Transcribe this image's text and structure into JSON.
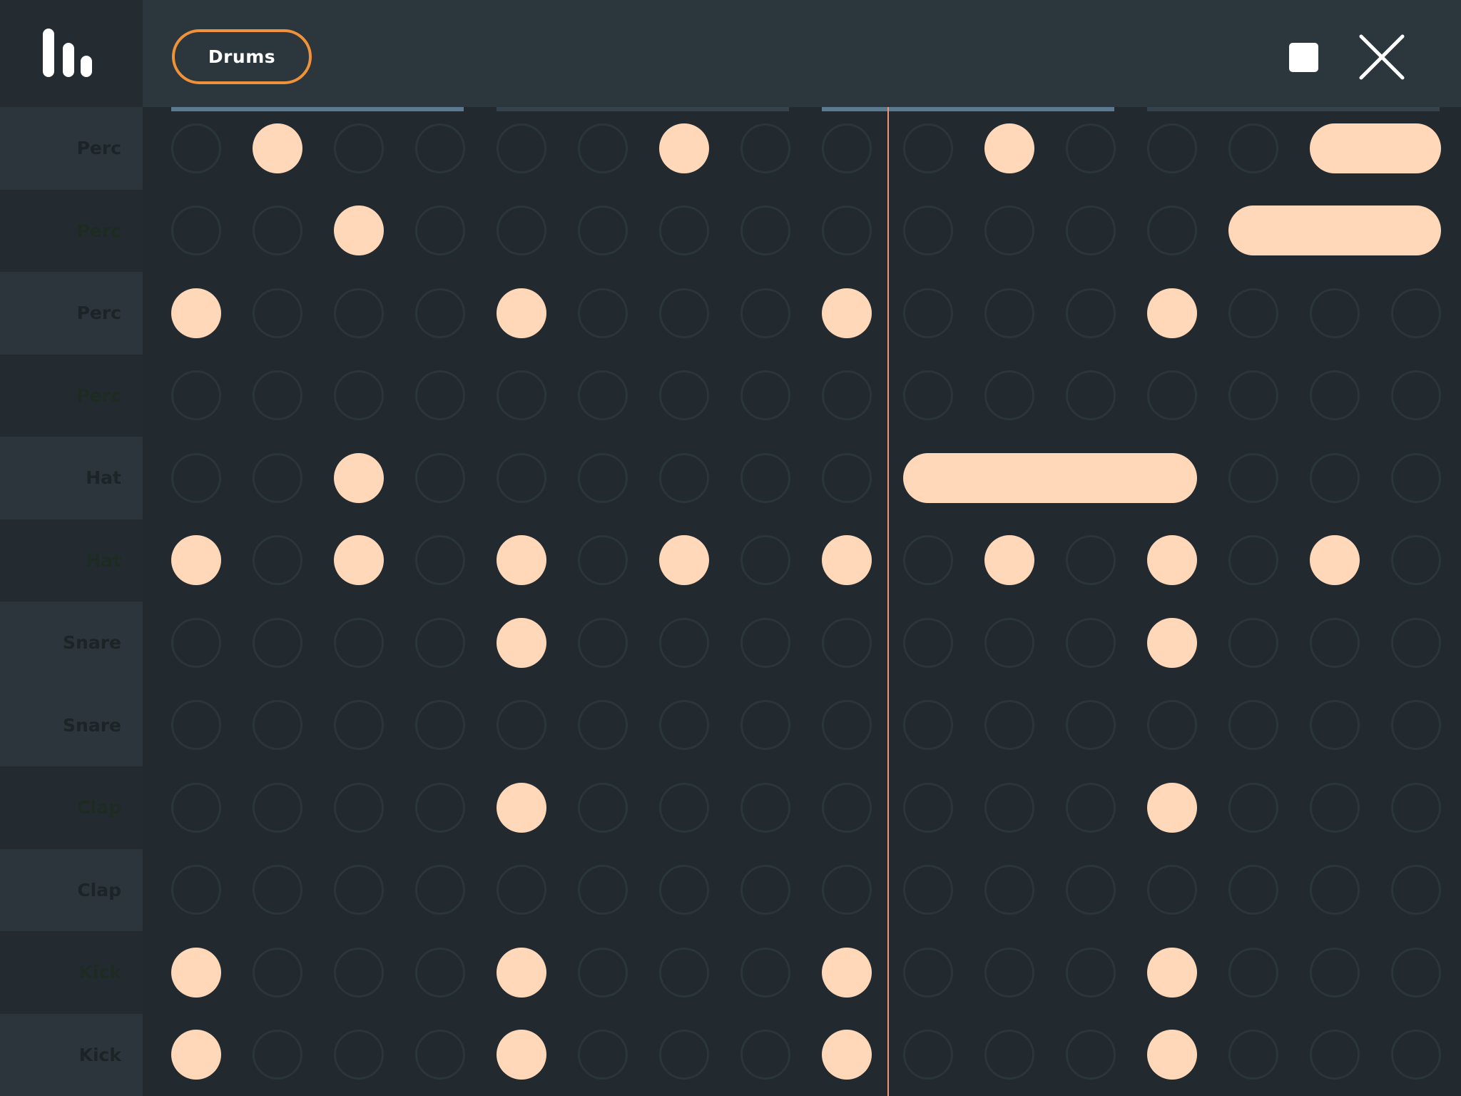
{
  "header": {
    "kit_label": "Drums",
    "logo_icon": "equalizer-bars-icon",
    "stop_icon": "stop-square-icon",
    "close_icon": "close-x-icon"
  },
  "colors": {
    "background": "#222a30",
    "topbar": "#2c363d",
    "accent_orange": "#f0923a",
    "note_fill": "#fed8b8",
    "empty_cell_ring": "#2b353c",
    "playhead": "#f39478",
    "bar_active": "#5b7a8f",
    "bar_inactive": "#34434d"
  },
  "sequencer": {
    "steps": 16,
    "playhead_step": 9,
    "bars": [
      {
        "active": true
      },
      {
        "active": false
      },
      {
        "active": true
      },
      {
        "active": false
      }
    ],
    "tracks": [
      {
        "label": "Perc",
        "shade": "light",
        "label_color": "dark",
        "notes": [
          [
            1,
            1
          ],
          [
            6,
            1
          ],
          [
            10,
            1
          ],
          [
            14,
            2
          ]
        ]
      },
      {
        "label": "Perc",
        "shade": "dark",
        "label_color": "green",
        "notes": [
          [
            2,
            1
          ],
          [
            13,
            3
          ]
        ]
      },
      {
        "label": "Perc",
        "shade": "light",
        "label_color": "dark",
        "notes": [
          [
            0,
            1
          ],
          [
            4,
            1
          ],
          [
            8,
            1
          ],
          [
            12,
            1
          ]
        ]
      },
      {
        "label": "Perc",
        "shade": "dark",
        "label_color": "green",
        "notes": []
      },
      {
        "label": "Hat",
        "shade": "light",
        "label_color": "dark",
        "notes": [
          [
            2,
            1
          ],
          [
            9,
            4
          ]
        ]
      },
      {
        "label": "Hat",
        "shade": "dark",
        "label_color": "green",
        "notes": [
          [
            0,
            1
          ],
          [
            2,
            1
          ],
          [
            4,
            1
          ],
          [
            6,
            1
          ],
          [
            8,
            1
          ],
          [
            10,
            1
          ],
          [
            12,
            1
          ],
          [
            14,
            1
          ]
        ]
      },
      {
        "label": "Snare",
        "shade": "light",
        "label_color": "dark",
        "notes": [
          [
            4,
            1
          ],
          [
            12,
            1
          ]
        ]
      },
      {
        "label": "Snare",
        "shade": "light",
        "label_color": "dark",
        "notes": []
      },
      {
        "label": "Clap",
        "shade": "dark",
        "label_color": "green",
        "notes": [
          [
            4,
            1
          ],
          [
            12,
            1
          ]
        ]
      },
      {
        "label": "Clap",
        "shade": "light",
        "label_color": "dark",
        "notes": []
      },
      {
        "label": "Kick",
        "shade": "dark",
        "label_color": "green",
        "notes": [
          [
            0,
            1
          ],
          [
            4,
            1
          ],
          [
            8,
            1
          ],
          [
            12,
            1
          ]
        ]
      },
      {
        "label": "Kick",
        "shade": "light",
        "label_color": "dark",
        "notes": [
          [
            0,
            1
          ],
          [
            4,
            1
          ],
          [
            8,
            1
          ],
          [
            12,
            1
          ]
        ]
      }
    ]
  }
}
